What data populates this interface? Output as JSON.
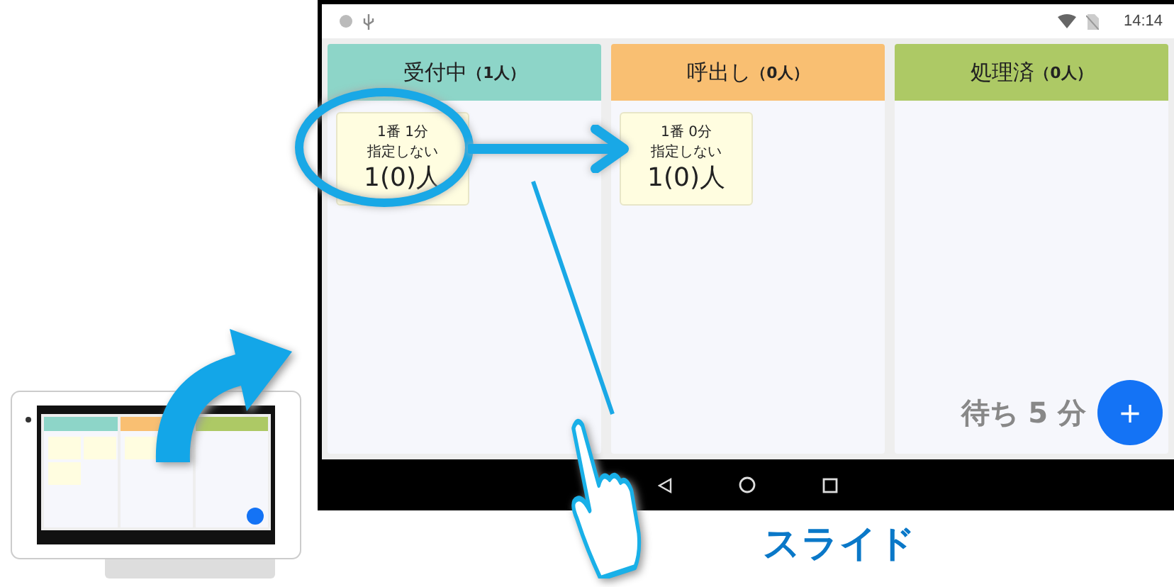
{
  "status_bar": {
    "time": "14:14"
  },
  "columns": [
    {
      "label": "受付中",
      "count": "（1人）",
      "color": "#8dd5c8",
      "cards": [
        {
          "number_line": "1番 1分",
          "staff": "指定しない",
          "people": "1(0)人"
        }
      ]
    },
    {
      "label": "呼出し",
      "count": "（0人）",
      "color": "#f9bf72",
      "cards": [
        {
          "number_line": "1番 0分",
          "staff": "指定しない",
          "people": "1(0)人"
        }
      ]
    },
    {
      "label": "処理済",
      "count": "（0人）",
      "color": "#adc965"
    }
  ],
  "wait": "待ち 5 分",
  "fab": "+",
  "caption": "スライド"
}
